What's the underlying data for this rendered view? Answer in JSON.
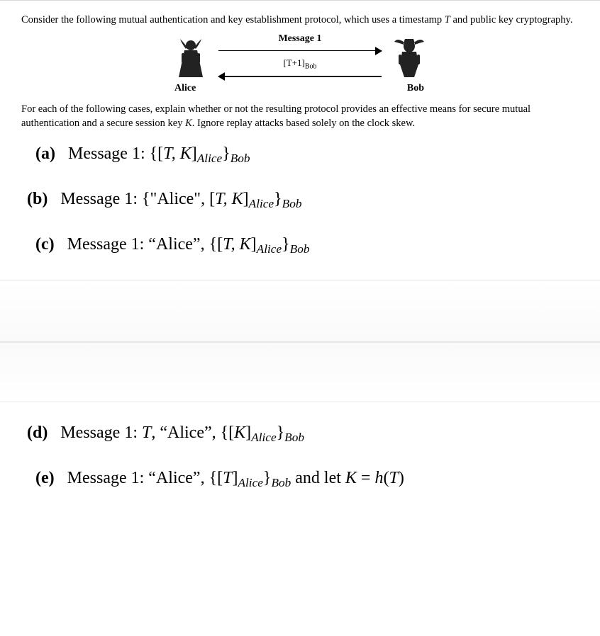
{
  "intro_line1": "Consider the following mutual authentication and key establishment protocol, which uses a timestamp ",
  "intro_tvar": "T",
  "intro_line2": " and public key cryptography.",
  "diagram": {
    "msg1_label": "Message 1",
    "msg2_label": "[T+1]",
    "msg2_sub": "Bob",
    "alice_name": "Alice",
    "bob_name": "Bob"
  },
  "question_line1": "For each of the following cases, explain whether or not the resulting protocol provides an effective means for secure mutual authentication and a secure session key ",
  "question_kvar": "K",
  "question_line2": ". Ignore replay attacks based solely on the clock skew.",
  "items": {
    "a": {
      "label": "(a)",
      "msg": "Message 1: ",
      "expr_open": "{[",
      "expr_vars": "T, K",
      "expr_close_sign": "]",
      "sub1": "Alice",
      "brace_close": "}",
      "sub2": "Bob"
    },
    "b": {
      "label": "(b)",
      "msg": "Message 1: ",
      "prefix": "{\"Alice\", [",
      "vars": "T, K",
      "close_sign": "]",
      "sub1": "Alice",
      "brace_close": "}",
      "sub2": "Bob"
    },
    "c": {
      "label": "(c)",
      "msg": "Message 1: ",
      "prefix": "“Alice”, {[",
      "vars": "T, K",
      "close_sign": "]",
      "sub1": "Alice",
      "brace_close": "}",
      "sub2": "Bob"
    },
    "d": {
      "label": "(d)",
      "msg": "Message 1: ",
      "prefix_t": "T",
      "prefix_rest": ", “Alice”, {[",
      "vars": "K",
      "close_sign": "]",
      "sub1": "Alice",
      "brace_close": "}",
      "sub2": "Bob"
    },
    "e": {
      "label": "(e)",
      "msg": "Message 1: ",
      "prefix": "“Alice”, {[",
      "vars": "T",
      "close_sign": "]",
      "sub1": "Alice",
      "brace_close": "}",
      "sub2": "Bob",
      "tail_pre": "   and let   ",
      "tail_eq_lhs": "K",
      "tail_eq_mid": " = ",
      "tail_eq_rhs_h": "h",
      "tail_eq_rhs_open": "(",
      "tail_eq_rhs_t": "T",
      "tail_eq_rhs_close": ")"
    }
  }
}
